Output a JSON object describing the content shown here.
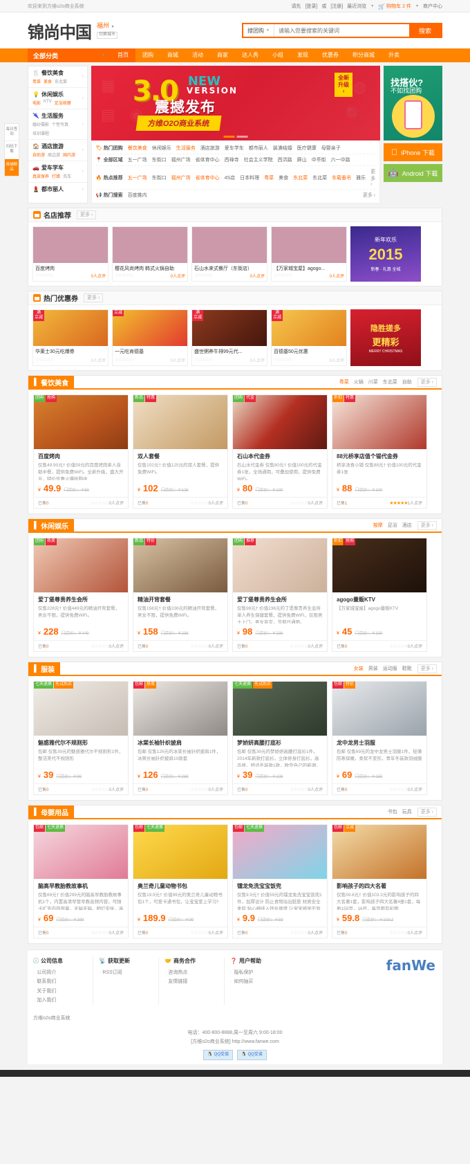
{
  "topbar": {
    "welcome": "欢迎来到方维o2o商业系统",
    "links": [
      "请先",
      "[登录]",
      "或",
      "[注册]",
      "最近浏览"
    ],
    "cart_label": "购物车",
    "cart_count": "2",
    "cart_unit": "件",
    "merchant_center": "商户中心"
  },
  "header": {
    "logo": "锦尚中国",
    "city": "福州",
    "switch_city": "切换城市",
    "search_category": "搜团购",
    "search_placeholder": "请输入您要搜索的关键词",
    "search_button": "搜索"
  },
  "mainnav": {
    "all_categories": "全部分类",
    "items": [
      {
        "label": "首页",
        "active": true
      },
      {
        "label": "团购",
        "active": false
      },
      {
        "label": "商城",
        "active": false
      },
      {
        "label": "活动",
        "active": false
      },
      {
        "label": "商家",
        "active": false
      },
      {
        "label": "达人秀",
        "active": false
      },
      {
        "label": "小组",
        "active": false
      },
      {
        "label": "发现",
        "active": false
      },
      {
        "label": "优惠券",
        "active": false
      },
      {
        "label": "积分商城",
        "active": false
      },
      {
        "label": "外卖",
        "active": false
      }
    ]
  },
  "rail": {
    "items": [
      {
        "label": "每日签到",
        "active": false
      },
      {
        "label": "扫码下载",
        "active": false
      },
      {
        "label": "商城精品",
        "active": true
      }
    ]
  },
  "categories": [
    {
      "title": "餐饮美食",
      "icon": "🍴",
      "subs": [
        {
          "t": "粤菜",
          "hot": true
        },
        {
          "t": "美食",
          "hot": true
        },
        {
          "t": "东北菜",
          "hot": false
        }
      ]
    },
    {
      "title": "休闲娱乐",
      "icon": "💡",
      "subs": [
        {
          "t": "电影",
          "hot": true
        },
        {
          "t": "KTV",
          "hot": false
        },
        {
          "t": "足浴按摩",
          "hot": true
        }
      ]
    },
    {
      "title": "生活服务",
      "icon": "🌂",
      "subs": [
        {
          "t": "婚纱摄影",
          "hot": false
        },
        {
          "t": "个性写真",
          "hot": false
        },
        {
          "t": "培训课程",
          "hot": false
        }
      ]
    },
    {
      "title": "酒店旅游",
      "icon": "🏠",
      "subs": [
        {
          "t": "自助游",
          "hot": true
        },
        {
          "t": "周边游",
          "hot": false
        },
        {
          "t": "国内游",
          "hot": true
        }
      ]
    },
    {
      "title": "爱车学车",
      "icon": "🚗",
      "subs": [
        {
          "t": "真皮保养",
          "hot": true
        },
        {
          "t": "打蜡",
          "hot": true
        },
        {
          "t": "洗车",
          "hot": false
        }
      ]
    },
    {
      "title": "都市丽人",
      "icon": "💄",
      "subs": []
    }
  ],
  "banner": {
    "version": "3.0",
    "new": "NEW",
    "version_label": "VERSION",
    "headline": "震撼发布",
    "badge_line1": "全新",
    "badge_line2": "升级",
    "badge_arrow": "›",
    "ribbon": "方维O2O商业系统"
  },
  "keywords": {
    "rows": [
      {
        "label": "热门团购",
        "icon": "tag-icon",
        "items": [
          {
            "t": "餐饮美食",
            "hl": true
          },
          {
            "t": "休闲娱乐",
            "hl": false
          },
          {
            "t": "生活服务",
            "hl": true
          },
          {
            "t": "酒店旅游",
            "hl": false
          },
          {
            "t": "爱车学车",
            "hl": false
          },
          {
            "t": "都市丽人",
            "hl": false
          },
          {
            "t": "装潢结婚",
            "hl": false
          },
          {
            "t": "医疗健康",
            "hl": false
          },
          {
            "t": "母婴亲子",
            "hl": false
          }
        ],
        "more": ""
      },
      {
        "label": "全部区域",
        "icon": "pin-icon",
        "items": [
          {
            "t": "五一广场",
            "hl": false
          },
          {
            "t": "东街口",
            "hl": false
          },
          {
            "t": "福州广场",
            "hl": false
          },
          {
            "t": "省体育中心",
            "hl": false
          },
          {
            "t": "西禅寺",
            "hl": false
          },
          {
            "t": "社会主义学院",
            "hl": false
          },
          {
            "t": "西洪路",
            "hl": false
          },
          {
            "t": "屏山",
            "hl": false
          },
          {
            "t": "中亭街",
            "hl": false
          },
          {
            "t": "六一中路",
            "hl": false
          }
        ],
        "more": ""
      },
      {
        "label": "热点推荐",
        "icon": "fire-icon",
        "items": [
          {
            "t": "五一广场",
            "hl": true
          },
          {
            "t": "东街口",
            "hl": false
          },
          {
            "t": "福州广场",
            "hl": true
          },
          {
            "t": "省体育中心",
            "hl": true
          },
          {
            "t": "4S店",
            "hl": false
          },
          {
            "t": "日本料理",
            "hl": false
          },
          {
            "t": "粤菜",
            "hl": true
          },
          {
            "t": "美食",
            "hl": false
          },
          {
            "t": "东北菜",
            "hl": true
          },
          {
            "t": "东北菜",
            "hl": false
          },
          {
            "t": "车载垂吊",
            "hl": true
          },
          {
            "t": "雅乐",
            "hl": false
          }
        ],
        "more": "更多 ›"
      },
      {
        "label": "热门搜索",
        "icon": "speaker-icon",
        "items": [
          {
            "t": "百度推内",
            "hl": false
          }
        ],
        "more": "更多 ›"
      }
    ]
  },
  "sideads": {
    "promo_title": "找搭伙?",
    "promo_sub": "不如找团购",
    "ios_label": "iPhone 下载",
    "ios_icon": "apple-icon",
    "android_label": "Android 下载",
    "android_icon": "android-icon"
  },
  "sections": {
    "famous_stores": {
      "title": "名店推荐",
      "more": "更多 ›",
      "cards": [
        {
          "name": "百度烤肉",
          "rating": "0人点评",
          "img": "img-food1"
        },
        {
          "name": "樱花风尚烤肉 韩式火锅自助",
          "rating": "0人点评",
          "img": "img-korea"
        },
        {
          "name": "石山水来式餐厅（东街店）",
          "rating": "0人点评",
          "img": "img-beef"
        },
        {
          "name": "【万家城宝屋】agogo...",
          "rating": "0人点评",
          "img": "img-hall"
        }
      ],
      "side_banner": {
        "line1": "新年欢乐",
        "year": "2015",
        "sub": "新春 · 礼惠 全城"
      }
    },
    "hot_coupons": {
      "title": "热门优惠券",
      "more": "更多 ›",
      "cards": [
        {
          "name": "华莱士30元吃爆券",
          "tag1": "满",
          "tag2": "立减",
          "rating": "0人点评",
          "img": "img-burger"
        },
        {
          "name": "一元吃肯德基",
          "tag1": "立减",
          "tag2": "",
          "rating": "0人点评",
          "img": "img-kfc"
        },
        {
          "name": "盛世粥养牛排99元代...",
          "tag1": "满",
          "tag2": "立减",
          "rating": "0人点评",
          "img": "img-steak"
        },
        {
          "name": "百德基50元优惠",
          "tag1": "满",
          "tag2": "立减",
          "rating": "0人点评",
          "img": "img-burg2"
        }
      ],
      "side_banner": {
        "line1": "隐胜搓多",
        "line2": "更精彩",
        "line3": "MERRY CHRISTMAS"
      }
    },
    "food": {
      "title": "餐饮美食",
      "icon": "fork-icon",
      "tabs": [
        {
          "label": "粤菜",
          "active": true
        },
        {
          "label": "火锅",
          "active": false
        },
        {
          "label": "川菜",
          "active": false
        },
        {
          "label": "东北菜",
          "active": false
        },
        {
          "label": "自助",
          "active": false
        }
      ],
      "more": "更多 ›",
      "products": [
        {
          "title": "百度烤肉",
          "desc": "仅售49.90元† 价值59元的百度烤肉单人自助半餐，提供免费WiFi。全新升级，盛大开业，特价优惠火爆抢购中",
          "price": "49.9",
          "old": "门店价：￥59",
          "sold": "0",
          "reviews": "0人点评",
          "stars": 0,
          "badges": [
            {
              "t": "团购",
              "c": "green"
            },
            {
              "t": "抢购",
              "c": "red"
            }
          ],
          "img": "img-food1",
          "buy_label": "已售"
        },
        {
          "title": "双人套餐",
          "desc": "仅售102元† 价值125元的双人套餐，提供免费WiFi。",
          "price": "102",
          "old": "门店价：￥125",
          "sold": "0",
          "reviews": "0人点评",
          "stars": 0,
          "badges": [
            {
              "t": "新品",
              "c": "green"
            },
            {
              "t": "特惠",
              "c": "red"
            }
          ],
          "img": "img-fish",
          "buy_label": "已售"
        },
        {
          "title": "石山本代金券",
          "desc": "石山水代金券 仅售80元† 价值100元的代金券1张，全场通用，可叠加使用，提供免费WiFi。",
          "price": "80",
          "old": "门店价：￥100",
          "sold": "0",
          "reviews": "0人点评",
          "stars": 0,
          "badges": [
            {
              "t": "团购",
              "c": "green"
            },
            {
              "t": "代金",
              "c": "red"
            }
          ],
          "img": "img-beef2",
          "buy_label": "已售"
        },
        {
          "title": "88元桥享店值个锡代金券",
          "desc": "桥享汤食小铺 仅售88元† 价值100元的代金券1张",
          "price": "88",
          "old": "门店价：￥100",
          "sold": "1",
          "reviews": "1人点评",
          "stars": 5,
          "badges": [
            {
              "t": "折扣",
              "c": "orange"
            },
            {
              "t": "特惠",
              "c": "red"
            }
          ],
          "img": "img-cake",
          "buy_label": "已售"
        }
      ]
    },
    "leisure": {
      "title": "休闲娱乐",
      "icon": "bulb-icon",
      "tabs": [
        {
          "label": "按摩",
          "active": true
        },
        {
          "label": "足浴",
          "active": false
        },
        {
          "label": "酒店",
          "active": false
        }
      ],
      "more": "更多 ›",
      "products": [
        {
          "title": "爱丁堡尊贵养生会所",
          "desc": "仅售228元† 价值449元的精油开背套餐，男女不限，提供免费WiFi。",
          "price": "228",
          "old": "门店价：￥449",
          "sold": "0",
          "reviews": "0人点评",
          "stars": 0,
          "badges": [
            {
              "t": "团购",
              "c": "green"
            },
            {
              "t": "热卖",
              "c": "red"
            }
          ],
          "img": "img-feet",
          "buy_label": "已售"
        },
        {
          "title": "精油开背套餐",
          "desc": "仅售158元† 价值236元的精油开背套餐，男女不限，提供免费WiFi。",
          "price": "158",
          "old": "门店价：￥236",
          "sold": "0",
          "reviews": "0人点评",
          "stars": 0,
          "badges": [
            {
              "t": "新品",
              "c": "green"
            },
            {
              "t": "特价",
              "c": "red"
            }
          ],
          "img": "img-room",
          "buy_label": "已售"
        },
        {
          "title": "爱丁堡尊贵养生会所",
          "desc": "仅售98元† 价值236元的丁堡尊贵养生会所单人养生保健套餐，提供免费WiFi，仅限男士上门。男女皆宜，节假日通用。",
          "price": "98",
          "old": "门店价：￥236",
          "sold": "0",
          "reviews": "0人点评",
          "stars": 0,
          "badges": [
            {
              "t": "团购",
              "c": "green"
            },
            {
              "t": "推荐",
              "c": "red"
            }
          ],
          "img": "img-leg",
          "buy_label": "已售"
        },
        {
          "title": "agogo量贩KTV",
          "desc": "【万家城宝屋】agogo量贩KTV",
          "price": "45",
          "old": "门店价：￥100",
          "sold": "0",
          "reviews": "0人点评",
          "stars": 0,
          "badges": [
            {
              "t": "折扣",
              "c": "orange"
            },
            {
              "t": "抢购",
              "c": "red"
            }
          ],
          "img": "img-ktv",
          "buy_label": "已售"
        }
      ]
    },
    "clothes": {
      "title": "服装",
      "icon": "shirt-icon",
      "tabs": [
        {
          "label": "女装",
          "active": true
        },
        {
          "label": "男装",
          "active": false
        },
        {
          "label": "运动服",
          "active": false
        },
        {
          "label": "鞋靴",
          "active": false
        }
      ],
      "more": "更多 ›",
      "products": [
        {
          "title": "魅惑雅代尔不规则形",
          "desc": "包邮 仅售39元的魅惑雅代尔不规则形1件，整洁美代不规则形",
          "price": "39",
          "old": "门店价：￥99",
          "sold": "0",
          "reviews": "0人点评",
          "stars": 0,
          "badges": [
            {
              "t": "七天退换",
              "c": "green"
            },
            {
              "t": "先试后买",
              "c": "orange"
            }
          ],
          "img": "img-cloth1",
          "buy_label": "已售"
        },
        {
          "title": "冰棠长袖针织披肩",
          "desc": "包邮 仅售126元的冰棠长袖针织披肩1件，冰爽长袖针织披肩10款套",
          "price": "126",
          "old": "门店价：￥268",
          "sold": "0",
          "reviews": "0人点评",
          "stars": 0,
          "badges": [
            {
              "t": "包邮",
              "c": "red"
            },
            {
              "t": "热卖",
              "c": "orange"
            }
          ],
          "img": "img-cloth2",
          "buy_label": "已售"
        },
        {
          "title": "梦娇妍高腰打底衫",
          "desc": "包邮 仅售39元的梦娇妍高腰打底衫1件，2014年新款打底衫，立体修身打底衫，高品质，舒适冬装款1款，欧货自己的新潮，颜色随意",
          "price": "39",
          "old": "门店价：￥108",
          "sold": "0",
          "reviews": "0人点评",
          "stars": 0,
          "badges": [
            {
              "t": "七天退换",
              "c": "green"
            },
            {
              "t": "先试后买",
              "c": "orange"
            }
          ],
          "img": "img-cloth3",
          "buy_label": "已售"
        },
        {
          "title": "龙中龙男士羽服",
          "desc": "包邮 仅售69元的龙中龙男士羽服1件，轻薄防寒保暖，柔软不变形，青年冬装款羽绒服",
          "price": "69",
          "old": "门店价：￥159",
          "sold": "0",
          "reviews": "0人点评",
          "stars": 0,
          "badges": [
            {
              "t": "包邮",
              "c": "red"
            },
            {
              "t": "特价",
              "c": "orange"
            }
          ],
          "img": "img-jacket",
          "buy_label": "已售"
        }
      ]
    },
    "baby": {
      "title": "母婴用品",
      "icon": "baby-icon",
      "tabs": [
        {
          "label": "书包",
          "active": false
        },
        {
          "label": "玩具",
          "active": false
        }
      ],
      "more": "更多 ›",
      "products": [
        {
          "title": "脑高早教胎教故事机",
          "desc": "仅售69元† 价值299元的脑高早教胎教故事机1个，内置高清早管早教音频内容，可随卡扩充内存容量，无辐无辐，明灯安抚，高保真HIFI喇叭",
          "price": "69",
          "old": "门店价：￥299",
          "sold": "0",
          "reviews": "0人点评",
          "stars": 0,
          "badges": [
            {
              "t": "包邮",
              "c": "red"
            },
            {
              "t": "七天退换",
              "c": "green"
            }
          ],
          "img": "img-baby1",
          "buy_label": "已售"
        },
        {
          "title": "奥兰奇儿童动物书包",
          "desc": "仅售19.9元† 价值99元的奥兰奇儿童动物书包1个，可爱卡通书包，让宝宝爱上学习†",
          "price": "189.9",
          "old": "门店价：￥99",
          "sold": "0",
          "reviews": "0人点评",
          "stars": 0,
          "badges": [
            {
              "t": "包邮",
              "c": "red"
            },
            {
              "t": "七天退换",
              "c": "green"
            }
          ],
          "img": "img-bee",
          "buy_label": "已售"
        },
        {
          "title": "镭龙免洗宝宝饭兜",
          "desc": "仅售9.9元† 价值59元的镭龙免洗宝宝饭兜1件，加厚设计 防止食物溢出脏脏 材质安全柔软 贴心细佳入怀化尿度 让宝宝感觉不到束缚 舒爽易清",
          "price": "9.9",
          "old": "门店价：￥59",
          "sold": "0",
          "reviews": "0人点评",
          "stars": 0,
          "badges": [
            {
              "t": "包邮",
              "c": "red"
            },
            {
              "t": "七天退换",
              "c": "green"
            }
          ],
          "img": "img-bib",
          "buy_label": "已售"
        },
        {
          "title": "影响孩子的四大名著",
          "desc": "仅售59.8元† 价值103.2元的影响孩子的四大名著1套，影响孩子四大名著4册1套，每册155页，16开，每页都有彩图",
          "price": "59.8",
          "old": "门店价：￥103.2",
          "sold": "0",
          "reviews": "0人点评",
          "stars": 0,
          "badges": [
            {
              "t": "包邮",
              "c": "red"
            },
            {
              "t": "立减",
              "c": "orange"
            }
          ],
          "img": "img-books",
          "buy_label": "已售"
        }
      ]
    }
  },
  "footer": {
    "columns": [
      {
        "title": "公司信息",
        "icon": "info-icon",
        "links": [
          "公司简介",
          "联系我们",
          "关于我们",
          "加入我们"
        ]
      },
      {
        "title": "获取更新",
        "icon": "rss-icon",
        "links": [
          "RSS订阅"
        ]
      },
      {
        "title": "商务合作",
        "icon": "handshake-icon",
        "links": [
          "咨询热点",
          "友情链接"
        ]
      },
      {
        "title": "用户帮助",
        "icon": "question-icon",
        "links": [
          "隐私保护",
          "如何抽买"
        ]
      }
    ],
    "logo": "fanWe",
    "system": "方维o2o商业系统",
    "phone": "电话：400-800-8888,周一至周六 9:00-18:00",
    "site": "[方维o2o商业系统] http://www.fanwe.com",
    "qq": [
      "QQ交谈",
      "QQ交谈"
    ]
  }
}
